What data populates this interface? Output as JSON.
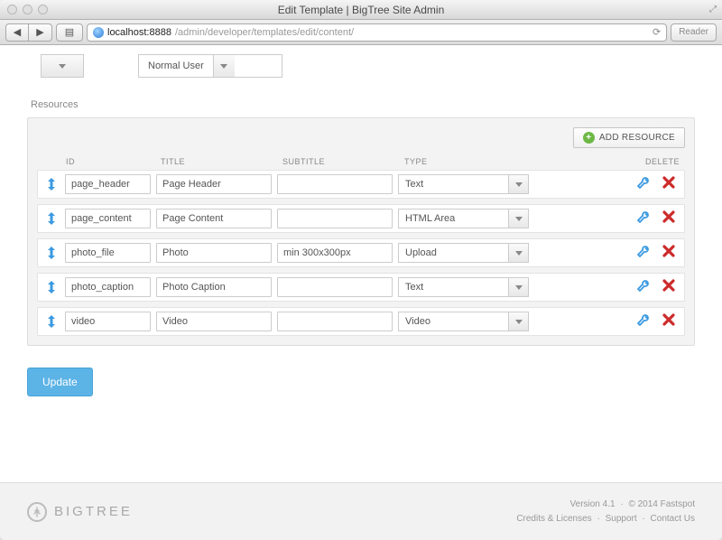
{
  "window": {
    "title": "Edit Template | BigTree Site Admin"
  },
  "url": {
    "host": "localhost:8888",
    "rest": "/admin/developer/templates/edit/content/"
  },
  "reader_label": "Reader",
  "top_dropdowns": {
    "level": "Normal User"
  },
  "section_label": "Resources",
  "add_resource_label": "ADD RESOURCE",
  "headers": {
    "id": "ID",
    "title": "TITLE",
    "subtitle": "SUBTITLE",
    "type": "TYPE",
    "delete": "DELETE"
  },
  "rows": [
    {
      "id": "page_header",
      "title": "Page Header",
      "subtitle": "",
      "type": "Text"
    },
    {
      "id": "page_content",
      "title": "Page Content",
      "subtitle": "",
      "type": "HTML Area"
    },
    {
      "id": "photo_file",
      "title": "Photo",
      "subtitle": "min 300x300px",
      "type": "Upload"
    },
    {
      "id": "photo_caption",
      "title": "Photo Caption",
      "subtitle": "",
      "type": "Text"
    },
    {
      "id": "video",
      "title": "Video",
      "subtitle": "",
      "type": "Video"
    }
  ],
  "update_label": "Update",
  "footer": {
    "brand": "BIGTREE",
    "version": "Version 4.1",
    "copyright": "© 2014 Fastspot",
    "links": {
      "credits": "Credits & Licenses",
      "support": "Support",
      "contact": "Contact Us"
    }
  }
}
